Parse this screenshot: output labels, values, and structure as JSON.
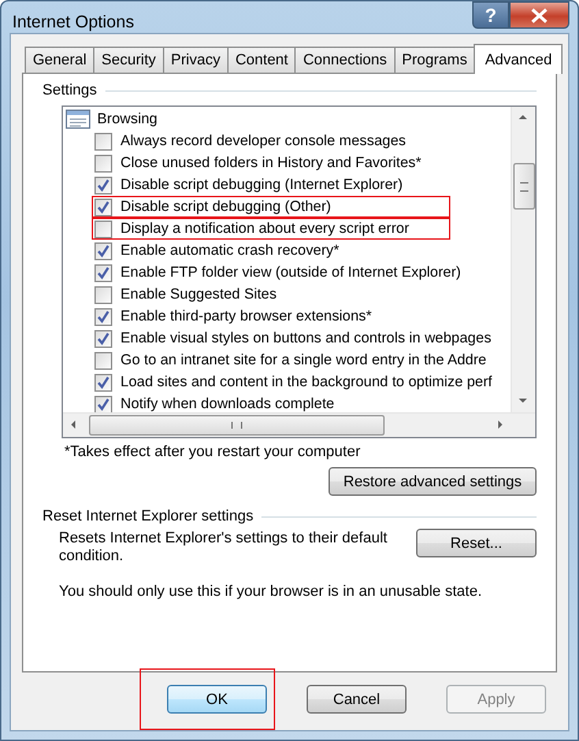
{
  "window": {
    "title": "Internet Options",
    "help_label": "?"
  },
  "tabs": [
    {
      "label": "General",
      "selected": false
    },
    {
      "label": "Security",
      "selected": false
    },
    {
      "label": "Privacy",
      "selected": false
    },
    {
      "label": "Content",
      "selected": false
    },
    {
      "label": "Connections",
      "selected": false
    },
    {
      "label": "Programs",
      "selected": false
    },
    {
      "label": "Advanced",
      "selected": true
    }
  ],
  "settings": {
    "title": "Settings",
    "category": "Browsing",
    "items": [
      {
        "label": "Always record developer console messages",
        "checked": false,
        "highlighted": false
      },
      {
        "label": "Close unused folders in History and Favorites*",
        "checked": false,
        "highlighted": false
      },
      {
        "label": "Disable script debugging (Internet Explorer)",
        "checked": true,
        "highlighted": false
      },
      {
        "label": "Disable script debugging (Other)",
        "checked": true,
        "highlighted": true
      },
      {
        "label": "Display a notification about every script error",
        "checked": false,
        "highlighted": true
      },
      {
        "label": "Enable automatic crash recovery*",
        "checked": true,
        "highlighted": false
      },
      {
        "label": "Enable FTP folder view (outside of Internet Explorer)",
        "checked": true,
        "highlighted": false
      },
      {
        "label": "Enable Suggested Sites",
        "checked": false,
        "highlighted": false
      },
      {
        "label": "Enable third-party browser extensions*",
        "checked": true,
        "highlighted": false
      },
      {
        "label": "Enable visual styles on buttons and controls in webpages",
        "checked": true,
        "highlighted": false
      },
      {
        "label": "Go to an intranet site for a single word entry in the Addre",
        "checked": false,
        "highlighted": false
      },
      {
        "label": "Load sites and content in the background to optimize perf",
        "checked": true,
        "highlighted": false
      },
      {
        "label": "Notify when downloads complete",
        "checked": true,
        "highlighted": false
      }
    ],
    "note": "*Takes effect after you restart your computer",
    "restore_button": "Restore advanced settings"
  },
  "reset": {
    "title": "Reset Internet Explorer settings",
    "description": "Resets Internet Explorer's settings to their default condition.",
    "button": "Reset...",
    "warning": "You should only use this if your browser is in an unusable state."
  },
  "buttons": [
    {
      "label": "OK",
      "highlighted": true,
      "disabled": false
    },
    {
      "label": "Cancel",
      "highlighted": false,
      "disabled": false
    },
    {
      "label": "Apply",
      "highlighted": false,
      "disabled": true
    }
  ]
}
